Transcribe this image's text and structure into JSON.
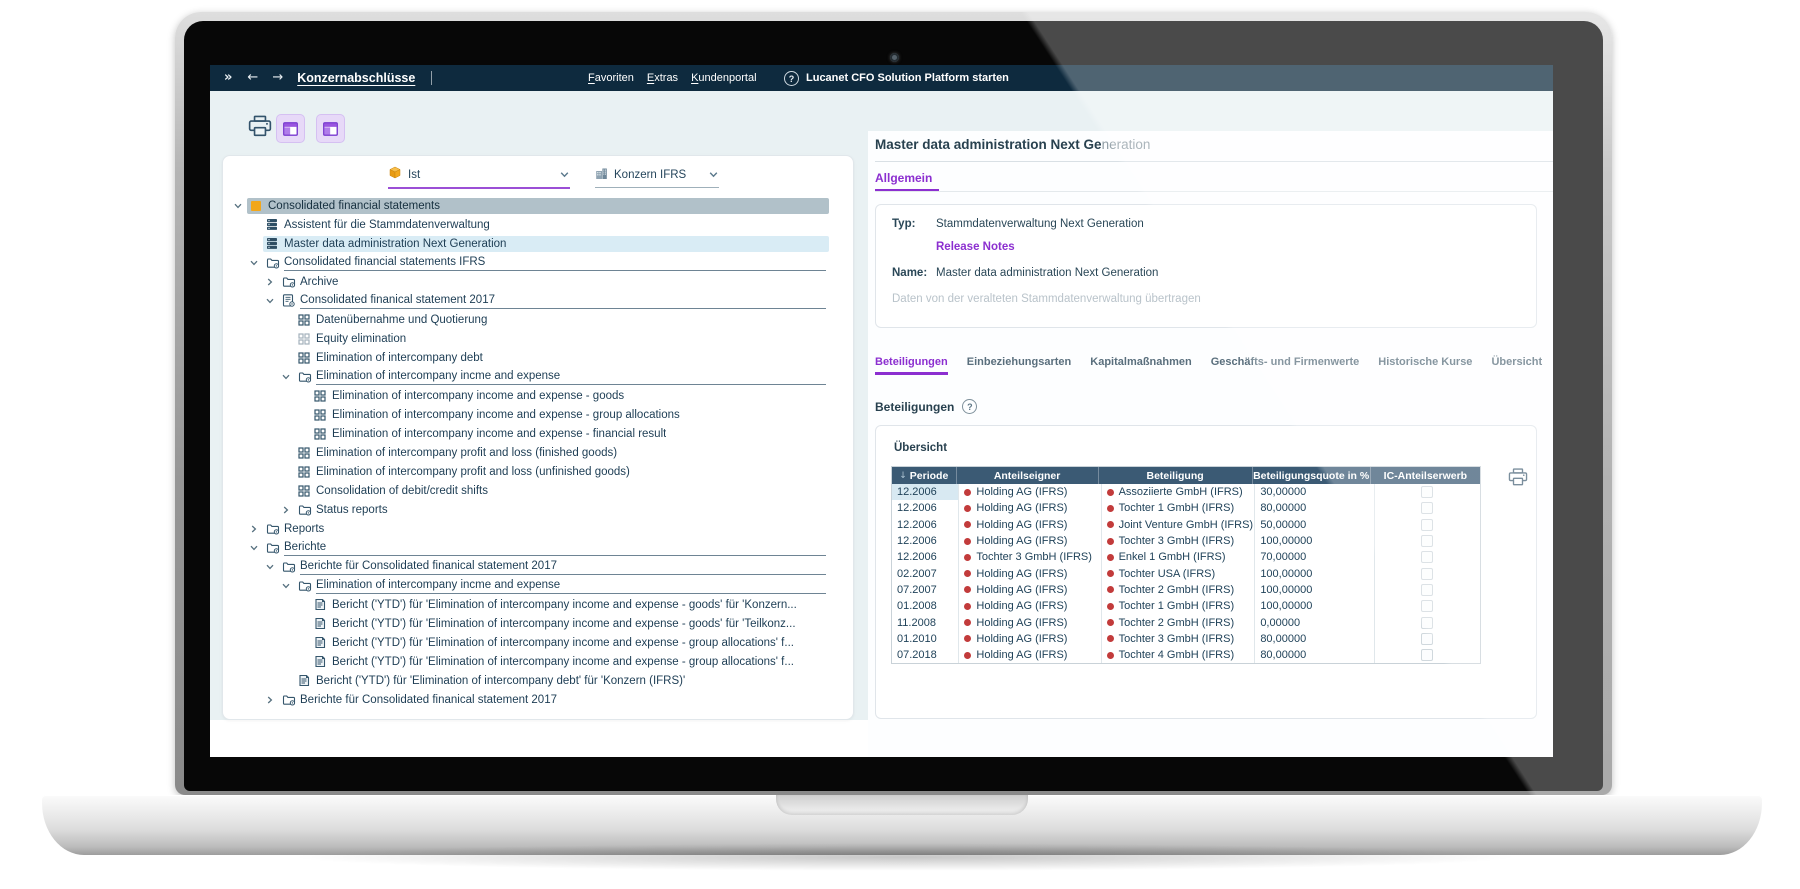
{
  "appbar": {
    "collapse_icon": "»",
    "back_icon": "←",
    "forward_icon": "→",
    "title": "Konzernabschlüsse",
    "menu": [
      "Favoriten",
      "Extras",
      "Kundenportal"
    ],
    "help_icon": "?",
    "app_link": "Lucanet CFO Solution Platform starten"
  },
  "toolbar": {
    "icons": [
      "print-icon",
      "layout-panel-icon",
      "layout-panel-icon"
    ]
  },
  "filters": {
    "scenario": {
      "value": "Ist",
      "icon": "cube-icon"
    },
    "group": {
      "value": "Konzern IFRS",
      "icon": "building-icon"
    }
  },
  "tree": {
    "items": [
      {
        "label": "Consolidated financial statements",
        "depth": 0,
        "icon": "orange-square-icon",
        "state": "expanded",
        "selected": true
      },
      {
        "label": "Assistent für die Stammdatenverwaltung",
        "depth": 1,
        "icon": "database-icon",
        "state": "leaf"
      },
      {
        "label": "Master data administration Next Generation",
        "depth": 1,
        "icon": "database-icon",
        "state": "leaf",
        "highlighted": true
      },
      {
        "label": "Consolidated financial statements IFRS",
        "depth": 1,
        "icon": "folder-gear-icon",
        "state": "expanded"
      },
      {
        "label": "Archive",
        "depth": 2,
        "icon": "folder-gear-icon",
        "state": "collapsed"
      },
      {
        "label": "Consolidated finanical statement 2017",
        "depth": 2,
        "icon": "document-gear-icon",
        "state": "expanded"
      },
      {
        "label": "Datenübernahme und Quotierung",
        "depth": 3,
        "icon": "grid-icon",
        "state": "leaf"
      },
      {
        "label": "Equity elimination",
        "depth": 3,
        "icon": "grid-icon",
        "state": "leaf",
        "muted": true
      },
      {
        "label": "Elimination of intercompany debt",
        "depth": 3,
        "icon": "grid-icon",
        "state": "leaf"
      },
      {
        "label": "Elimination of intercompany incme and expense",
        "depth": 3,
        "icon": "folder-gear-icon",
        "state": "expanded"
      },
      {
        "label": "Elimination of intercompany income and expense - goods",
        "depth": 4,
        "icon": "grid-icon",
        "state": "leaf"
      },
      {
        "label": "Elimination of intercompany income and expense - group allocations",
        "depth": 4,
        "icon": "grid-icon",
        "state": "leaf"
      },
      {
        "label": "Elimination of intercompany income and expense - financial result",
        "depth": 4,
        "icon": "grid-icon",
        "state": "leaf"
      },
      {
        "label": "Elimination of intercompany profit and loss (finished goods)",
        "depth": 3,
        "icon": "grid-icon",
        "state": "leaf"
      },
      {
        "label": "Elimination of intercompany profit and loss (unfinished goods)",
        "depth": 3,
        "icon": "grid-icon",
        "state": "leaf"
      },
      {
        "label": "Consolidation of debit/credit shifts",
        "depth": 3,
        "icon": "grid-icon",
        "state": "leaf"
      },
      {
        "label": "Status reports",
        "depth": 3,
        "icon": "folder-gear-icon",
        "state": "collapsed"
      },
      {
        "label": "Reports",
        "depth": 1,
        "icon": "folder-gear-icon",
        "state": "collapsed"
      },
      {
        "label": "Berichte",
        "depth": 1,
        "icon": "folder-gear-icon",
        "state": "expanded"
      },
      {
        "label": "Berichte für Consolidated finanical statement 2017",
        "depth": 2,
        "icon": "folder-gear-icon",
        "state": "expanded"
      },
      {
        "label": "Elimination of intercompany incme and expense",
        "depth": 3,
        "icon": "folder-gear-icon",
        "state": "expanded"
      },
      {
        "label": "Bericht ('YTD') für 'Elimination of intercompany income and expense - goods' für 'Konzern...",
        "depth": 4,
        "icon": "report-icon",
        "state": "leaf"
      },
      {
        "label": "Bericht ('YTD') für 'Elimination of intercompany income and expense - goods' für 'Teilkonz...",
        "depth": 4,
        "icon": "report-icon",
        "state": "leaf"
      },
      {
        "label": "Bericht ('YTD') für 'Elimination of intercompany income and expense - group allocations' f...",
        "depth": 4,
        "icon": "report-icon",
        "state": "leaf"
      },
      {
        "label": "Bericht ('YTD') für 'Elimination of intercompany income and expense - group allocations' f...",
        "depth": 4,
        "icon": "report-icon",
        "state": "leaf"
      },
      {
        "label": "Bericht ('YTD') für 'Elimination of intercompany debt' für 'Konzern (IFRS)'",
        "depth": 3,
        "icon": "report-icon",
        "state": "leaf"
      },
      {
        "label": "Berichte für Consolidated finanical statement 2017",
        "depth": 2,
        "icon": "folder-gear-icon",
        "state": "collapsed"
      }
    ]
  },
  "detail": {
    "title_main": "Master data administration Next Ge",
    "title_faded": "neration",
    "general_tab": "Allgemein",
    "type_label": "Typ:",
    "type_value": "Stammdatenverwaltung Next Generation",
    "release_notes_link": "Release Notes",
    "name_label": "Name:",
    "name_value": "Master data administration Next Generation",
    "migrate_note": "Daten von der veralteten Stammdatenverwaltung übertragen",
    "tabs": [
      "Beteiligungen",
      "Einbeziehungsarten",
      "Kapitalmaßnahmen",
      "Geschäfts- und Firmenwerte",
      "Historische Kurse",
      "Übersicht"
    ],
    "active_tab": "Beteiligungen"
  },
  "beteiligungen": {
    "heading": "Beteiligungen",
    "help_icon": "?",
    "subheading": "Übersicht",
    "table": {
      "sort_icon": "↓",
      "columns": [
        "Periode",
        "Anteilseigner",
        "Beteiligung",
        "Beteiligungsquote in %",
        "IC-Anteilserwerb"
      ],
      "rows": [
        {
          "periode": "12.2006",
          "anteilseigner": "Holding AG (IFRS)",
          "beteiligung": "Assoziierte GmbH (IFRS)",
          "quote": "30,00000",
          "ic_checked": false
        },
        {
          "periode": "12.2006",
          "anteilseigner": "Holding AG (IFRS)",
          "beteiligung": "Tochter 1 GmbH (IFRS)",
          "quote": "80,00000",
          "ic_checked": false
        },
        {
          "periode": "12.2006",
          "anteilseigner": "Holding AG (IFRS)",
          "beteiligung": "Joint Venture GmbH (IFRS)",
          "quote": "50,00000",
          "ic_checked": false
        },
        {
          "periode": "12.2006",
          "anteilseigner": "Holding AG (IFRS)",
          "beteiligung": "Tochter 3 GmbH (IFRS)",
          "quote": "100,00000",
          "ic_checked": false
        },
        {
          "periode": "12.2006",
          "anteilseigner": "Tochter 3 GmbH (IFRS)",
          "beteiligung": "Enkel 1 GmbH (IFRS)",
          "quote": "70,00000",
          "ic_checked": false
        },
        {
          "periode": "02.2007",
          "anteilseigner": "Holding AG (IFRS)",
          "beteiligung": "Tochter USA (IFRS)",
          "quote": "100,00000",
          "ic_checked": false
        },
        {
          "periode": "07.2007",
          "anteilseigner": "Holding AG (IFRS)",
          "beteiligung": "Tochter 2 GmbH (IFRS)",
          "quote": "100,00000",
          "ic_checked": false
        },
        {
          "periode": "01.2008",
          "anteilseigner": "Holding AG (IFRS)",
          "beteiligung": "Tochter 1 GmbH (IFRS)",
          "quote": "100,00000",
          "ic_checked": false
        },
        {
          "periode": "11.2008",
          "anteilseigner": "Holding AG (IFRS)",
          "beteiligung": "Tochter 2 GmbH (IFRS)",
          "quote": "0,00000",
          "ic_checked": false
        },
        {
          "periode": "01.2010",
          "anteilseigner": "Holding AG (IFRS)",
          "beteiligung": "Tochter 3 GmbH (IFRS)",
          "quote": "80,00000",
          "ic_checked": false
        },
        {
          "periode": "07.2018",
          "anteilseigner": "Holding AG (IFRS)",
          "beteiligung": "Tochter 4 GmbH (IFRS)",
          "quote": "80,00000",
          "ic_checked": false
        }
      ]
    }
  },
  "colors": {
    "header_navy": "#0E2A3E",
    "app_background": "#E9F1F3",
    "accent_purple": "#8C2FD0",
    "toolbar_button_lavender": "#E7D9F8",
    "table_header_slate": "#3B5A74",
    "status_dot_red": "#C23B3B",
    "tree_selection_gray": "#B1C1C9",
    "tree_highlight_blue": "#D9ECF5",
    "orange_node": "#F2A71B"
  }
}
